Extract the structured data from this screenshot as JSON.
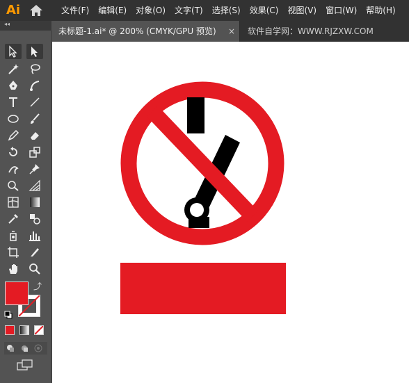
{
  "app": {
    "logo_text": "Ai"
  },
  "menu": [
    "文件(F)",
    "编辑(E)",
    "对象(O)",
    "文字(T)",
    "选择(S)",
    "效果(C)",
    "视图(V)",
    "窗口(W)",
    "帮助(H)"
  ],
  "tabs": {
    "active_title": "未标题-1.ai* @ 200% (CMYK/GPU 预览)",
    "close_glyph": "×",
    "inactive_title": "软件自学网：WWW.RJZXW.COM"
  },
  "toolbar": {
    "collapse_glyph": "◂◂",
    "swap_glyph": "⤴"
  },
  "colors": {
    "fill": "#e41b23",
    "sign_red": "#e41b23",
    "sign_black": "#000000",
    "canvas": "#ffffff"
  }
}
